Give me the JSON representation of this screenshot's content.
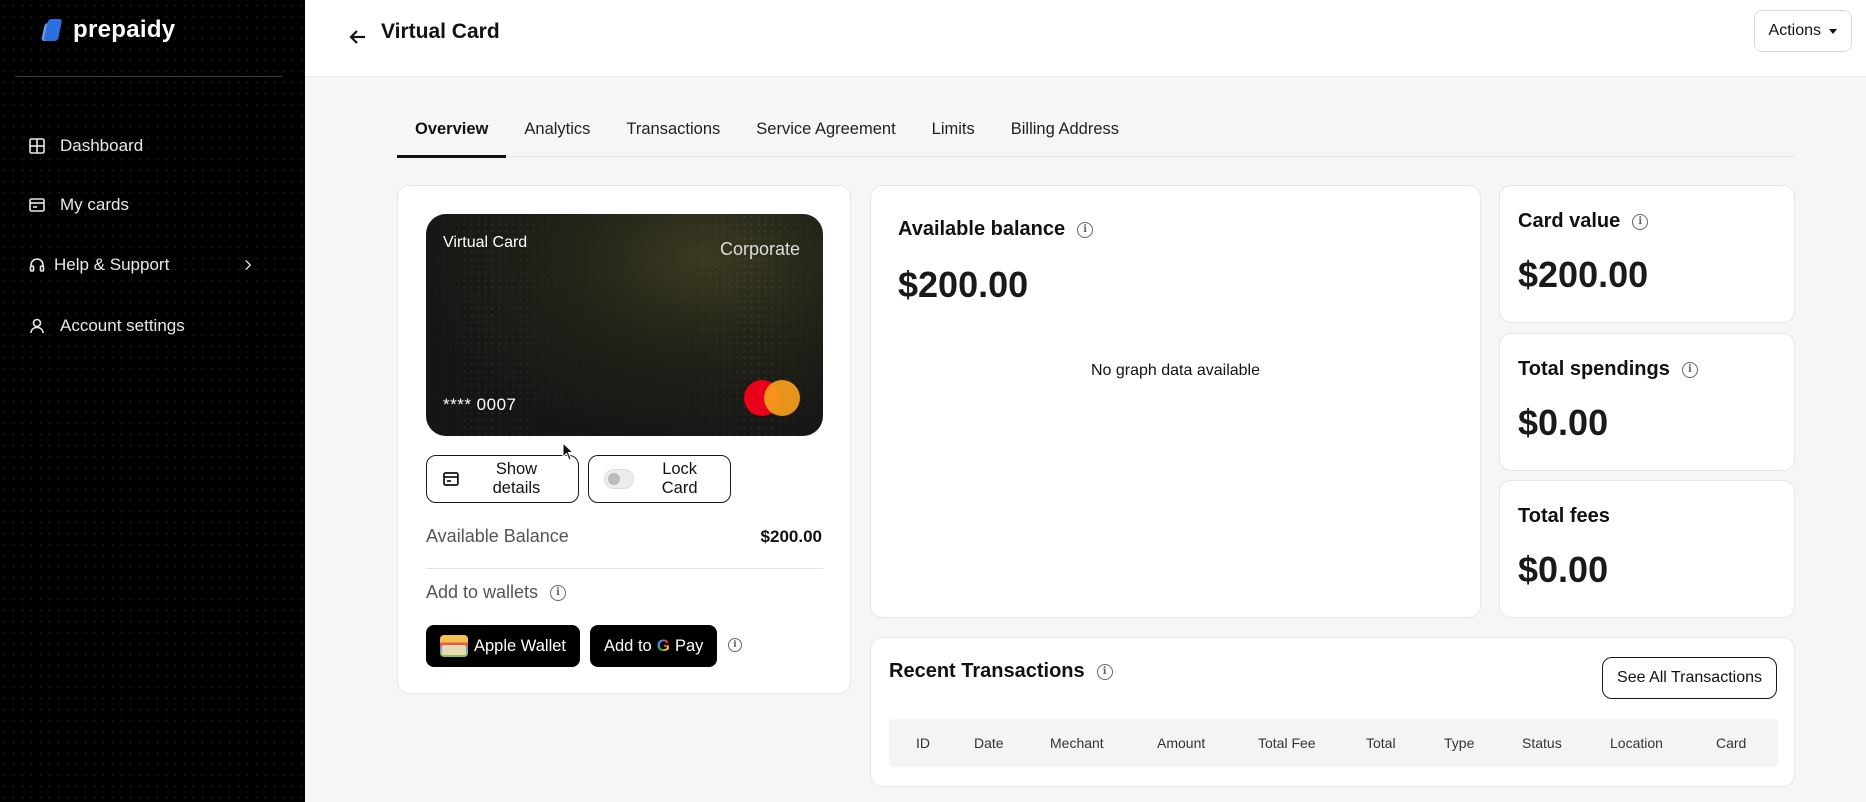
{
  "app": {
    "brand": "prepaidy"
  },
  "sidebar": {
    "items": [
      {
        "label": "Dashboard",
        "icon": "grid-icon"
      },
      {
        "label": "My cards",
        "icon": "card-icon"
      },
      {
        "label": "Help & Support",
        "icon": "headset-icon"
      },
      {
        "label": "Account settings",
        "icon": "user-icon"
      }
    ]
  },
  "header": {
    "title": "Virtual Card",
    "actions_label": "Actions"
  },
  "tabs": [
    {
      "label": "Overview",
      "active": true
    },
    {
      "label": "Analytics"
    },
    {
      "label": "Transactions"
    },
    {
      "label": "Service Agreement"
    },
    {
      "label": "Limits"
    },
    {
      "label": "Billing Address"
    }
  ],
  "card": {
    "title": "Virtual Card",
    "type": "Corporate",
    "number": "**** 0007",
    "network": "mastercard",
    "show_details_label": "Show details",
    "lock_label": "Lock Card",
    "locked": false,
    "available_balance_label": "Available Balance",
    "available_balance_value": "$200.00",
    "wallets_label": "Add to wallets",
    "apple_wallet_label": "Apple Wallet",
    "gpay_prefix": "Add to",
    "gpay_g": "G",
    "gpay_suffix": "Pay"
  },
  "balance": {
    "title": "Available balance",
    "value": "$200.00",
    "empty_text": "No graph data available"
  },
  "stats": [
    {
      "title": "Card value",
      "value": "$200.00"
    },
    {
      "title": "Total spendings",
      "value": "$0.00"
    },
    {
      "title": "Total fees",
      "value": "$0.00"
    }
  ],
  "transactions": {
    "title": "Recent Transactions",
    "see_all_label": "See All Transactions",
    "columns": [
      "ID",
      "Date",
      "Mechant",
      "Amount",
      "Total Fee",
      "Total",
      "Type",
      "Status",
      "Location",
      "Card"
    ]
  },
  "colors": {
    "accent": "#111111",
    "sidebar_bg": "#000000",
    "logo_blue": "#2c6fe0"
  }
}
